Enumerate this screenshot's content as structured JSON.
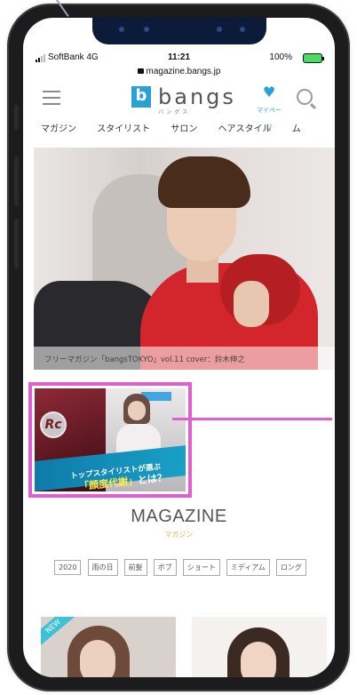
{
  "status_bar": {
    "carrier": "SoftBank 4G",
    "time": "11:21",
    "battery": "100%"
  },
  "url": "magazine.bangs.jp",
  "header": {
    "logo_mark": "b",
    "logo_text": "bangs",
    "logo_sub": "バングス",
    "mypage_label": "マイページ"
  },
  "nav": {
    "items": [
      "マガジン",
      "スタイリスト",
      "サロン",
      "ヘアスタイル",
      "ム"
    ]
  },
  "hero": {
    "caption": "フリーマガジン「bangsTOKYO」vol.11 cover：鈴木伸之"
  },
  "promo": {
    "logo": "Rc",
    "line1": "トップスタイリストが選ぶ",
    "line2_highlight": "「顔度代謝」",
    "line2_rest": "とは？"
  },
  "magazine": {
    "title": "MAGAZINE",
    "subtitle": "マガジン",
    "tags": [
      "2020",
      "雨の日",
      "前髪",
      "ボブ",
      "ショート",
      "ミディアム",
      "ロング"
    ]
  },
  "thumbs": {
    "new_badge": "NEW"
  },
  "colors": {
    "brand_blue": "#2aa0d8",
    "highlight_pink": "#e05fcf",
    "gold": "#d3b94a"
  },
  "icons": [
    "menu-icon",
    "heart-icon",
    "search-icon",
    "lock-icon",
    "signal-icon",
    "battery-icon"
  ]
}
